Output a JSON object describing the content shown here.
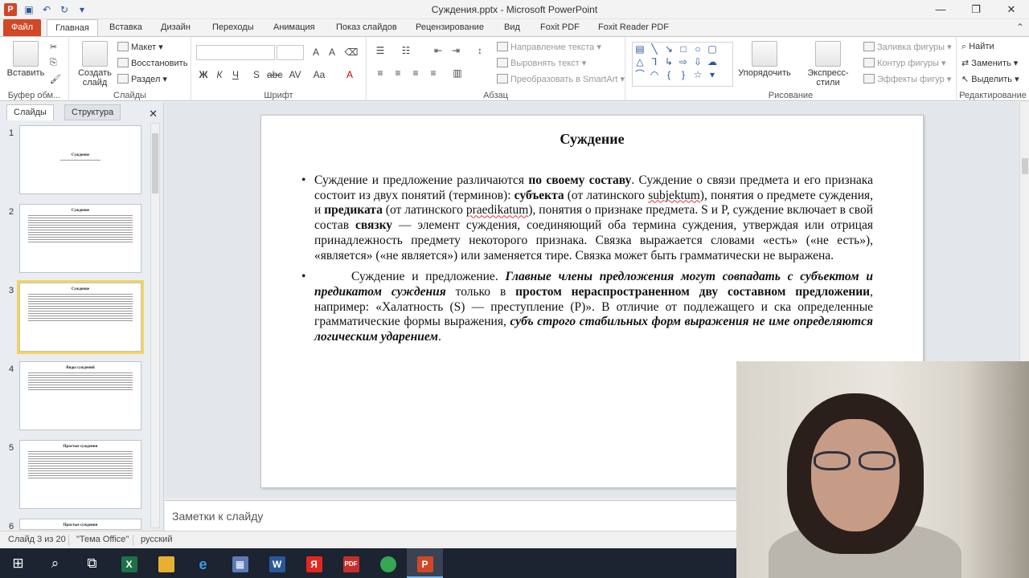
{
  "window": {
    "title": "Суждения.pptx - Microsoft PowerPoint",
    "app_icon_letter": "P"
  },
  "ribbon_tabs": [
    "Файл",
    "Главная",
    "Вставка",
    "Дизайн",
    "Переходы",
    "Анимация",
    "Показ слайдов",
    "Рецензирование",
    "Вид",
    "Foxit PDF",
    "Foxit Reader PDF"
  ],
  "ribbon": {
    "clipboard": {
      "paste": "Вставить",
      "label": "Буфер обм..."
    },
    "slides": {
      "new_slide": "Создать слайд",
      "layout": "Макет",
      "reset": "Восстановить",
      "section": "Раздел",
      "label": "Слайды"
    },
    "font": {
      "label": "Шрифт",
      "bold": "Ж",
      "italic": "К",
      "underline": "Ч",
      "strike": "S",
      "spacing": "abc",
      "case": "Aa",
      "grow": "A",
      "shrink": "A"
    },
    "paragraph": {
      "text_direction": "Направление текста",
      "align_text": "Выровнять текст",
      "smartart": "Преобразовать в SmartArt",
      "label": "Абзац"
    },
    "drawing": {
      "arrange": "Упорядочить",
      "quick_styles": "Экспресс-стили",
      "fill": "Заливка фигуры",
      "outline": "Контур фигуры",
      "effects": "Эффекты фигур",
      "label": "Рисование"
    },
    "editing": {
      "find": "Найти",
      "replace": "Заменить",
      "select": "Выделить",
      "label": "Редактирование"
    }
  },
  "left_pane": {
    "tabs": [
      "Слайды",
      "Структура"
    ],
    "thumbnails": [
      {
        "num": "1",
        "title": "Суждение"
      },
      {
        "num": "2",
        "title": "Суждение"
      },
      {
        "num": "3",
        "title": "Суждение"
      },
      {
        "num": "4",
        "title": "Виды суждений"
      },
      {
        "num": "5",
        "title": "Простые суждения"
      },
      {
        "num": "6",
        "title": "Простые суждения"
      }
    ]
  },
  "slide": {
    "title": "Суждение",
    "b1": {
      "t1": "Суждение и предложение различаются ",
      "t2": "по своему составу",
      "t3": ". Суждение о связи предмета и его признака состоит из двух понятий (терминов): ",
      "t4": "субъекта",
      "t5": " (от латинского ",
      "t6": "subjektum",
      "t7": "), понятия о предмете суждения, и ",
      "t8": "предиката",
      "t9": " (от латинского ",
      "t10": "praedikatum",
      "t11": "), понятия о признаке предмета. S и P, суждение включает в свой состав ",
      "t12": "связку",
      "t13": " — элемент суждения, соединяющий оба термина суждения, утверждая или отрицая принадлежность предмету некоторого признака. Связка выражается словами «есть» («не есть»), «является» («не является») или заменяется тире. Связка может быть грамматически не выражена."
    },
    "b2": {
      "t1": "Суждение и предложение. ",
      "t2": "Главные члены предложения могут совпадать с субъектом и предикатом суждения",
      "t3": " только в ",
      "t4": "простом нераспространенном дву составном предложении",
      "t5": ", например: «Халатность (S) — преступление (P)». В отличие от подлежащего и ска",
      "t6": " определенные грамматические формы выражения, ",
      "t7": "субъ",
      "t8": " строго стабильных форм выражения не име",
      "t9": " определяются логическим ударением",
      "t10": "."
    }
  },
  "notes": {
    "placeholder": "Заметки к слайду"
  },
  "status": {
    "slide_info": "Слайд 3 из 20",
    "theme": "\"Тема Office\"",
    "language": "русский"
  },
  "taskbar": {
    "items": [
      "windows-start",
      "search",
      "task-view",
      "excel",
      "file-explorer",
      "edge",
      "calculator",
      "word",
      "yandex",
      "pdf",
      "chrome",
      "powerpoint"
    ]
  },
  "colors": {
    "file_tab": "#d24726",
    "selected_thumb": "#f7d35c",
    "taskbar": "#1c2331"
  }
}
